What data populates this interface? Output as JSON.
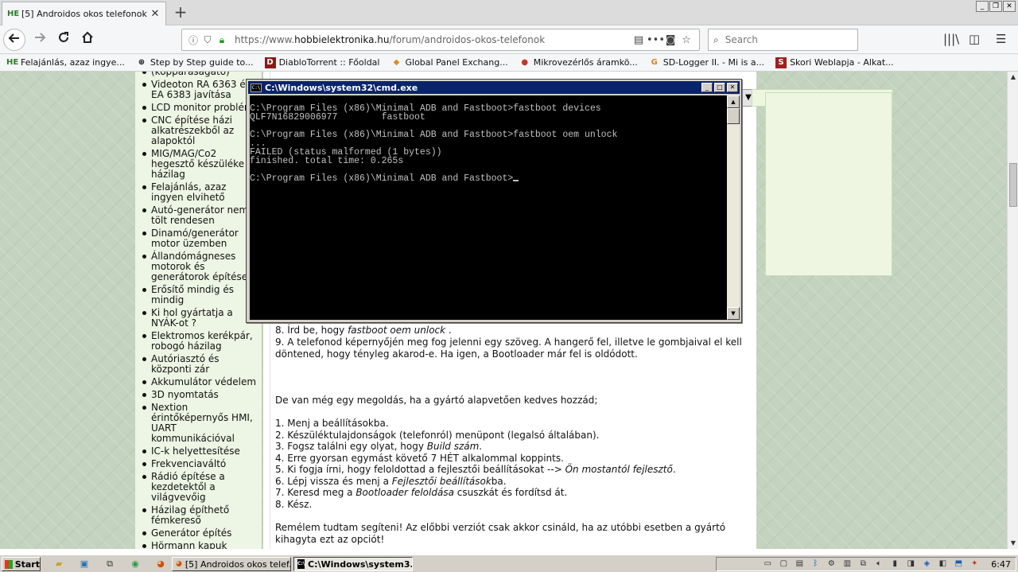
{
  "browser": {
    "tab": {
      "favicon": "HE",
      "title": "[5] Androidos okos telefonok - Hob",
      "close": "✕"
    },
    "new_tab": "+",
    "window_controls": [
      "_",
      "❐",
      "✕"
    ],
    "url": {
      "prefix": "https://www.",
      "domain": "hobbielektronika.hu",
      "path": "/forum/androidos-okos-telefonok"
    },
    "search_placeholder": "Search",
    "bookmarks": [
      {
        "icon": "HE",
        "label": "Felajánlás, azaz ingye..."
      },
      {
        "icon": "⊕",
        "label": "Step by Step guide to..."
      },
      {
        "icon": "D",
        "label": "DiabloTorrent :: Főoldal"
      },
      {
        "icon": "◆",
        "label": "Global Panel Exchang..."
      },
      {
        "icon": "●",
        "label": "Mikrovezérlős áramkö..."
      },
      {
        "icon": "G",
        "label": "SD-Logger II. - Mi is a..."
      },
      {
        "icon": "S",
        "label": "Skori Weblapja - Alkat..."
      }
    ]
  },
  "sidebar": {
    "items": [
      "(kopparaságátó)",
      "Videoton RA 6363 és\nEA 6383 javítása",
      "LCD monitor problém",
      "CNC építése házi\nalkatrészekből az\nalapoktól",
      "MIG/MAG/Co2\nhegesztő készüléke\nházilag",
      "Felajánlás, azaz\ningyen elvihető",
      "Autó-generátor nem\ntölt rendesen",
      "Dinamó/generátor\nmotor üzemben",
      "Állandómágneses\nmotorok és\ngenerátorok építése",
      "Erősítő mindig és\nmindig",
      "Ki hol gyártatja a\nNYÁK-ot ?",
      "Elektromos kerékpár,\nrobogó házilag",
      "Autóriasztó és\nközponti zár",
      "Akkumulátor védelem",
      "3D nyomtatás",
      "Nextion\nérintőképernyős HMI,\nUART kommunikációval",
      "IC-k helyettesítése",
      "Frekvenciaváltó",
      "Rádió építése a\nkezdetektől a\nvilágvevőig",
      "Házilag építhető\nfémkereső",
      "Generátor építés",
      "Hörmann kapuk"
    ]
  },
  "article": {
    "step8_pre": "8. Írd be, hogy ",
    "step8_em": "fastboot oem unlock",
    "step8_post": " .",
    "step9_line1": "9. A telefonod képernyőjén meg fog jelenni egy szöveg. A hangerő fel, illetve le gombjaival el kell",
    "step9_line2": "döntened, hogy tényleg akarod-e. Ha igen, a Bootloader már fel is oldódott.",
    "intro": "De van még egy megoldás, ha a gyártó alapvetően kedves hozzád;",
    "s1": "1. Menj a beállításokba.",
    "s2": "2. Készüléktulajdonságok (telefonról) menüpont (legalsó általában).",
    "s3_pre": "3. Fogsz találni egy olyat, hogy ",
    "s3_em": "Build szám",
    "s3_post": ".",
    "s4": "4. Erre gyorsan egymást követő 7 HÉT alkalommal koppints.",
    "s5_pre": "5. Ki fogja írni, hogy feloldottad a fejlesztői beállításokat --> ",
    "s5_em": "Ön mostantól fejlesztő",
    "s5_post": ".",
    "s6_pre": "6. Lépj vissza és menj a ",
    "s6_em": "Fejlesztői beállítások",
    "s6_post": "ba.",
    "s7_pre": "7. Keresd meg a ",
    "s7_em": "Bootloader feloldása",
    "s7_post": " csuszkát és fordítsd át.",
    "s8": "8. Kész.",
    "outro_line1": "Remélem tudtam segíteni! Az előbbi verziót csak akkor csináld, ha az utóbbi esetben a gyártó",
    "outro_line2": "kihagyta ezt az opciót!"
  },
  "cmd": {
    "title": "C:\\Windows\\system32\\cmd.exe",
    "icon": "C:\\",
    "buttons": [
      "_",
      "□",
      "✕"
    ],
    "lines": [
      "C:\\Program Files (x86)\\Minimal ADB and Fastboot>fastboot devices",
      "QLF7N16829006977        fastboot",
      "",
      "C:\\Program Files (x86)\\Minimal ADB and Fastboot>fastboot oem unlock",
      "...",
      "FAILED (status malformed (1 bytes))",
      "finished. total time: 0.265s",
      "",
      "C:\\Program Files (x86)\\Minimal ADB and Fastboot>"
    ]
  },
  "taskbar": {
    "start": "Start",
    "tasks": [
      {
        "icon": "🦊",
        "label": "[5] Androidos okos telef...",
        "active": false
      },
      {
        "icon": "C:\\",
        "label": "C:\\Windows\\system3...",
        "active": true
      }
    ],
    "clock": "6:47"
  },
  "colors": {
    "titlebar": "#0a246a",
    "console_bg": "#000000",
    "console_fg": "#c0c0c0",
    "sidebar_bg": "#edf5e4",
    "page_bg": "#c3d3bf"
  }
}
